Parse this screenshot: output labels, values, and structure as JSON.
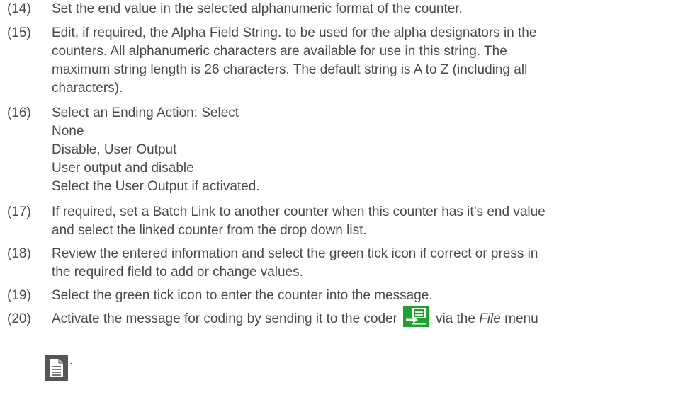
{
  "steps": [
    {
      "number": "(14)",
      "lines": [
        "Set the end value in the selected alphanumeric format of the counter."
      ]
    },
    {
      "number": "(15)",
      "lines": [
        "Edit, if required, the Alpha Field String. to be used for the alpha designators in the",
        "counters. All alphanumeric characters are available for use in this string. The",
        "maximum string length is 26 characters. The default string is A to Z (including all",
        "characters)."
      ]
    },
    {
      "number": "(16)",
      "lines": [
        "Select an Ending Action: Select",
        "None",
        "Disable, User Output",
        "User output and disable",
        "Select the User Output if activated."
      ]
    },
    {
      "number": "(17)",
      "lines": [
        "If required, set a Batch Link to another counter when this counter has it’s end value",
        "and select the linked counter from the drop down list."
      ]
    },
    {
      "number": "(18)",
      "lines": [
        "Review the entered information and select the green tick icon if correct or press in",
        "the required field to add or change values."
      ]
    },
    {
      "number": "(19)",
      "lines": [
        "Select the green tick icon to enter the counter into the message."
      ]
    },
    {
      "number": "(20)",
      "text_before_icon": "Activate the message for coding by sending it to the coder",
      "text_via": "via the",
      "text_file": "File",
      "text_menu": "menu",
      "trailing": "."
    }
  ],
  "icons": {
    "send_to_coder": "send-to-coder-icon",
    "file_menu": "file-menu-icon",
    "send_icon_color": "#1fa02f",
    "file_icon_color": "#555555"
  }
}
